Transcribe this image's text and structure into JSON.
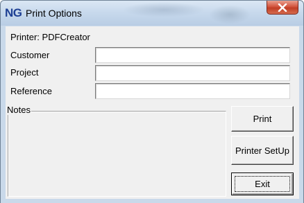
{
  "window": {
    "logo": "NG",
    "title": "Print Options"
  },
  "printer": {
    "label": "Printer:",
    "name": "PDFCreator"
  },
  "fields": {
    "customer_label": "Customer",
    "customer_value": "",
    "project_label": "Project",
    "project_value": "",
    "reference_label": "Reference",
    "reference_value": ""
  },
  "notes": {
    "label": "Notes"
  },
  "buttons": {
    "print": "Print",
    "printer_setup": "Printer SetUp",
    "exit": "Exit"
  },
  "icons": {
    "close": "close-icon"
  },
  "colors": {
    "close_button": "#c03e25",
    "logo": "#1d3f93",
    "titlebar": "#c6d8ec",
    "dialog_background": "#f0f0f0"
  }
}
